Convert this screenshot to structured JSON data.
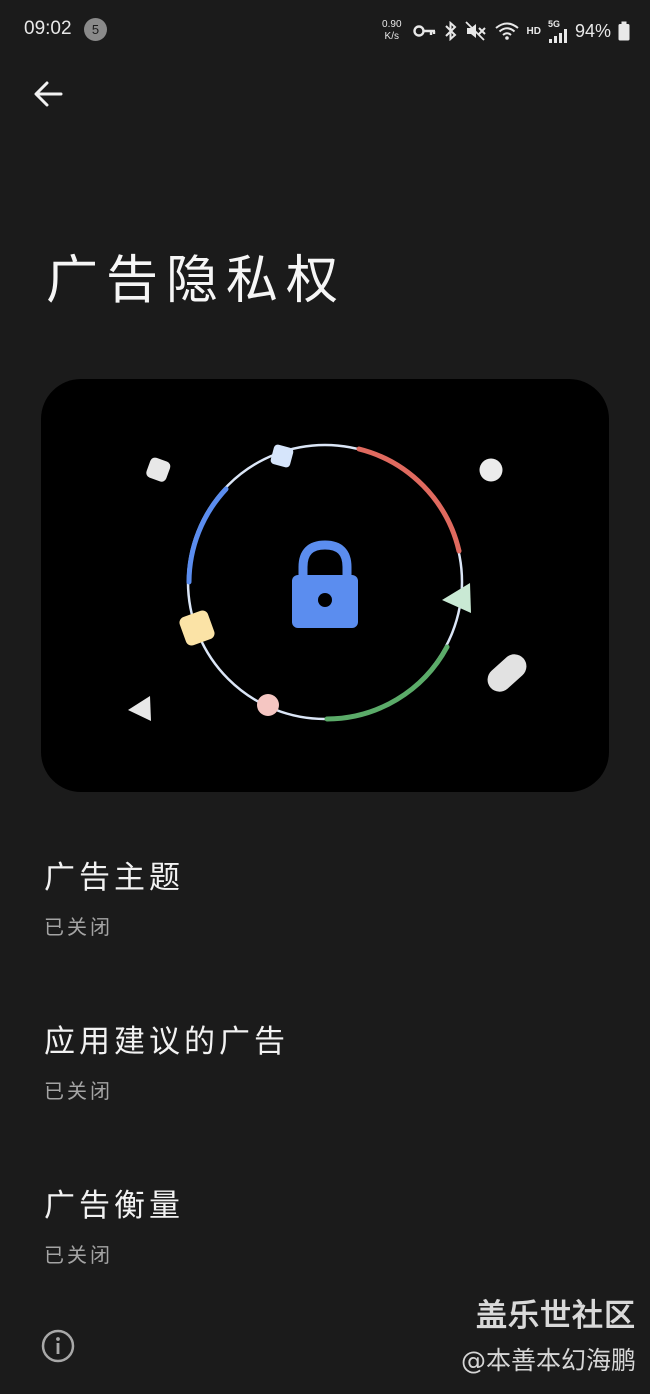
{
  "status_bar": {
    "time": "09:02",
    "notification_count": "5",
    "net_speed_value": "0.90",
    "net_speed_unit": "K/s",
    "network_label": "HD",
    "signal_label": "5G",
    "battery": "94%"
  },
  "page": {
    "title": "广告隐私权"
  },
  "settings": [
    {
      "title": "广告主题",
      "summary": "已关闭"
    },
    {
      "title": "应用建议的广告",
      "summary": "已关闭"
    },
    {
      "title": "广告衡量",
      "summary": "已关闭"
    }
  ],
  "watermark": {
    "title": "盖乐世社区",
    "author": "@本善本幻海鹏"
  },
  "colors": {
    "background": "#1b1b1b",
    "lock": "#5b8def",
    "ring_red": "#e06a5f",
    "ring_green": "#5bab69",
    "ring_blue": "#5b8def",
    "ring_base": "#dbe6f7",
    "shape_yellow": "#fbe3a6",
    "shape_pink": "#f5c6c2",
    "shape_mint": "#c9e9d4",
    "shape_light_blue": "#d6e5fb"
  }
}
